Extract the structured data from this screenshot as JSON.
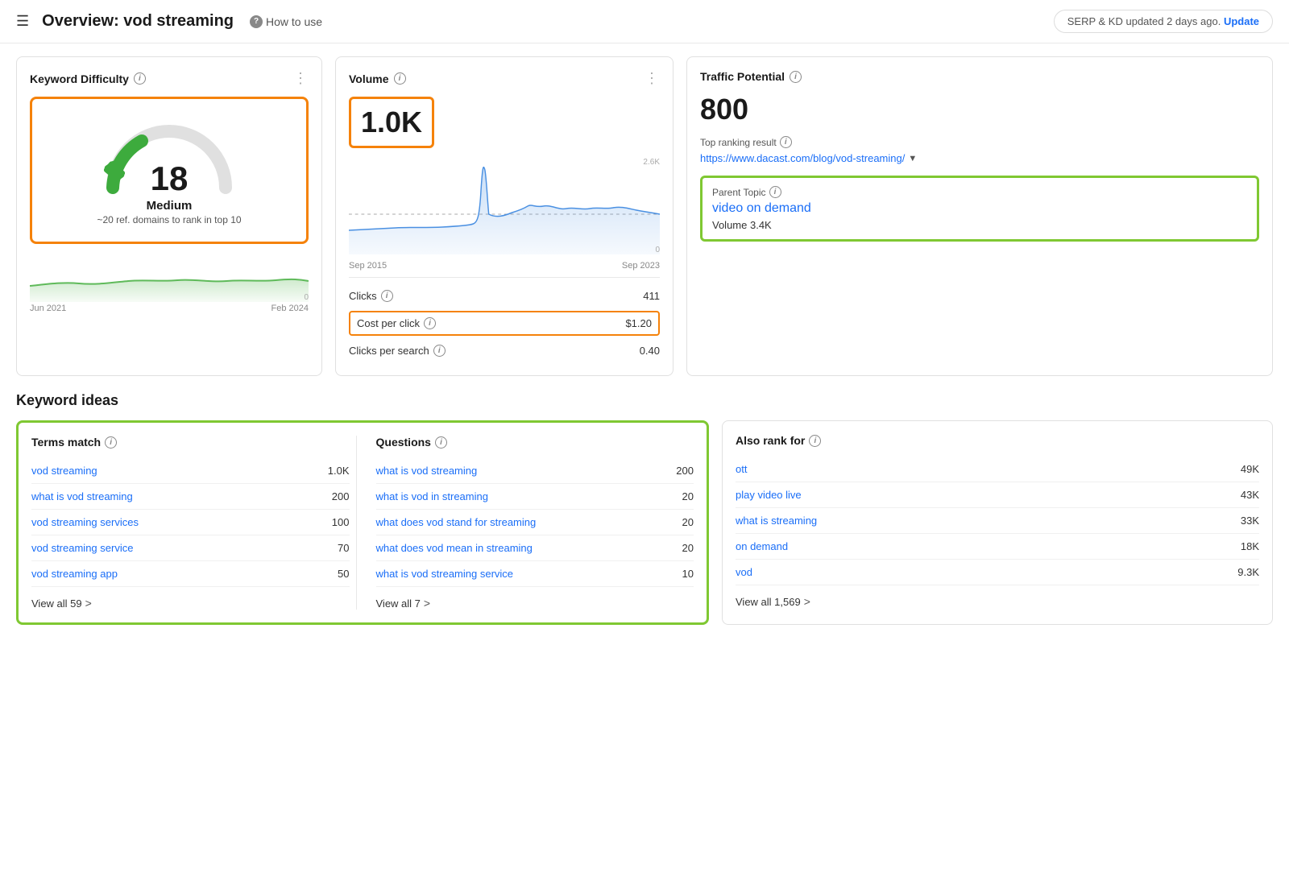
{
  "header": {
    "title": "Overview: vod streaming",
    "hamburger_label": "☰",
    "how_to_use_label": "How to use",
    "serp_notice": "SERP & KD updated 2 days ago.",
    "update_label": "Update"
  },
  "kd_card": {
    "title": "Keyword Difficulty",
    "number": "18",
    "difficulty_label": "Medium",
    "sublabel": "~20 ref. domains to rank in top 10",
    "trend_date_start": "Jun 2021",
    "trend_date_end": "Feb 2024",
    "trend_zero": "0",
    "card_max": "100"
  },
  "volume_card": {
    "title": "Volume",
    "number": "1.0K",
    "chart_max": "2.6K",
    "chart_zero": "0",
    "date_start": "Sep 2015",
    "date_end": "Sep 2023",
    "metrics": [
      {
        "label": "Clicks",
        "value": "411"
      },
      {
        "label": "Cost per click",
        "value": "$1.20",
        "highlight": true
      },
      {
        "label": "Clicks per search",
        "value": "0.40"
      }
    ]
  },
  "traffic_card": {
    "title": "Traffic Potential",
    "number": "800",
    "top_ranking_label": "Top ranking result",
    "url": "https://www.dacast.com/blog/vod-streaming/",
    "parent_topic_label": "Parent Topic",
    "parent_topic_link": "video on demand",
    "parent_topic_volume": "Volume 3.4K"
  },
  "keyword_ideas": {
    "title": "Keyword ideas",
    "terms_match": {
      "label": "Terms match",
      "items": [
        {
          "text": "vod streaming",
          "count": "1.0K"
        },
        {
          "text": "what is vod streaming",
          "count": "200"
        },
        {
          "text": "vod streaming services",
          "count": "100"
        },
        {
          "text": "vod streaming service",
          "count": "70"
        },
        {
          "text": "vod streaming app",
          "count": "50"
        }
      ],
      "view_all_label": "View all 59",
      "view_all_count": "59"
    },
    "questions": {
      "label": "Questions",
      "items": [
        {
          "text": "what is vod streaming",
          "count": "200"
        },
        {
          "text": "what is vod in streaming",
          "count": "20"
        },
        {
          "text": "what does vod stand for streaming",
          "count": "20"
        },
        {
          "text": "what does vod mean in streaming",
          "count": "20"
        },
        {
          "text": "what is vod streaming service",
          "count": "10"
        }
      ],
      "view_all_label": "View all 7",
      "view_all_count": "7"
    },
    "also_rank": {
      "label": "Also rank for",
      "items": [
        {
          "text": "ott",
          "count": "49K"
        },
        {
          "text": "play video live",
          "count": "43K"
        },
        {
          "text": "what is streaming",
          "count": "33K"
        },
        {
          "text": "on demand",
          "count": "18K"
        },
        {
          "text": "vod",
          "count": "9.3K"
        }
      ],
      "view_all_label": "View all 1,569",
      "view_all_count": "1,569"
    }
  },
  "colors": {
    "orange": "#f5820a",
    "green": "#7fc832",
    "blue_link": "#1a6ef7",
    "gauge_green": "#3dab3d",
    "chart_blue": "#4a90e2",
    "trend_green": "#5fba5a"
  }
}
